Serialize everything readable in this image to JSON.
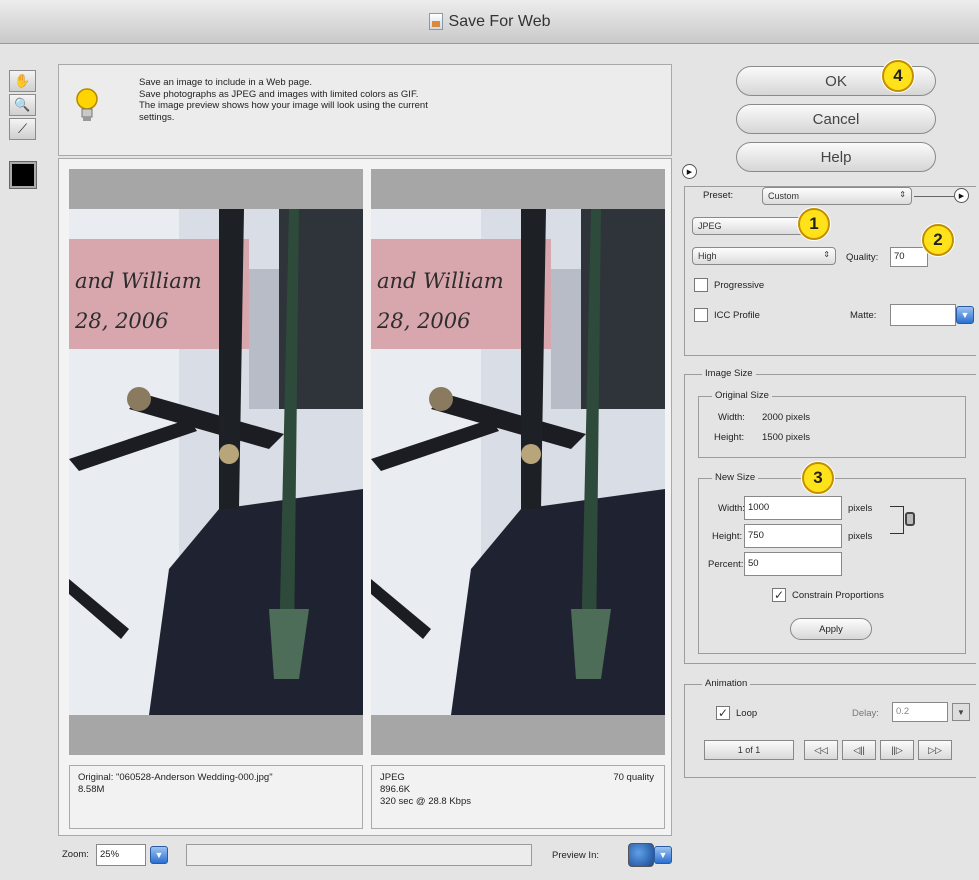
{
  "window": {
    "title": "Save For Web"
  },
  "tools": [
    {
      "name": "hand-tool-icon",
      "glyph": "✋"
    },
    {
      "name": "zoom-tool-icon",
      "glyph": "🔍"
    },
    {
      "name": "eyedropper-tool-icon",
      "glyph": "⟋"
    }
  ],
  "info": {
    "lines": [
      "Save an image to include in a Web page.",
      "Save photographs as JPEG and images with limited colors as GIF.",
      "The image preview shows how your image will look using the current",
      "settings."
    ]
  },
  "preview": {
    "overlay_line1": "and William",
    "overlay_line2": "28, 2006",
    "left_caption": {
      "line1": "Original: \"060528-Anderson Wedding-000.jpg\"",
      "line2": "8.58M"
    },
    "right_caption": {
      "line1": "JPEG",
      "line2": "896.6K",
      "line3": "320 sec @ 28.8 Kbps",
      "quality": "70 quality"
    }
  },
  "buttons": {
    "ok": "OK",
    "cancel": "Cancel",
    "help": "Help"
  },
  "badges": [
    "1",
    "2",
    "3",
    "4"
  ],
  "settings": {
    "preset_label": "Preset:",
    "preset_value": "Custom",
    "format_value": "JPEG",
    "quality_level_value": "High",
    "quality_label": "Quality:",
    "quality_value": "70",
    "progressive_label": "Progressive",
    "icc_label": "ICC Profile",
    "matte_label": "Matte:"
  },
  "image_size": {
    "title": "Image Size",
    "original_title": "Original Size",
    "orig_width_label": "Width:",
    "orig_width": "2000 pixels",
    "orig_height_label": "Height:",
    "orig_height": "1500 pixels",
    "new_title": "New Size",
    "width_label": "Width:",
    "width_value": "1000",
    "height_label": "Height:",
    "height_value": "750",
    "percent_label": "Percent:",
    "percent_value": "50",
    "unit": "pixels",
    "constrain_label": "Constrain Proportions",
    "apply_label": "Apply"
  },
  "animation": {
    "title": "Animation",
    "loop_label": "Loop",
    "delay_label": "Delay:",
    "delay_value": "0.2",
    "frame_counter": "1 of 1",
    "controls": [
      "◁◁",
      "◁||",
      "||▷",
      "▷▷"
    ]
  },
  "zoom": {
    "label": "Zoom:",
    "value": "25%"
  },
  "preview_in": {
    "label": "Preview In:"
  },
  "colors": {
    "badge": "#ffe21a",
    "accent_blue": "#2b6fd0"
  }
}
